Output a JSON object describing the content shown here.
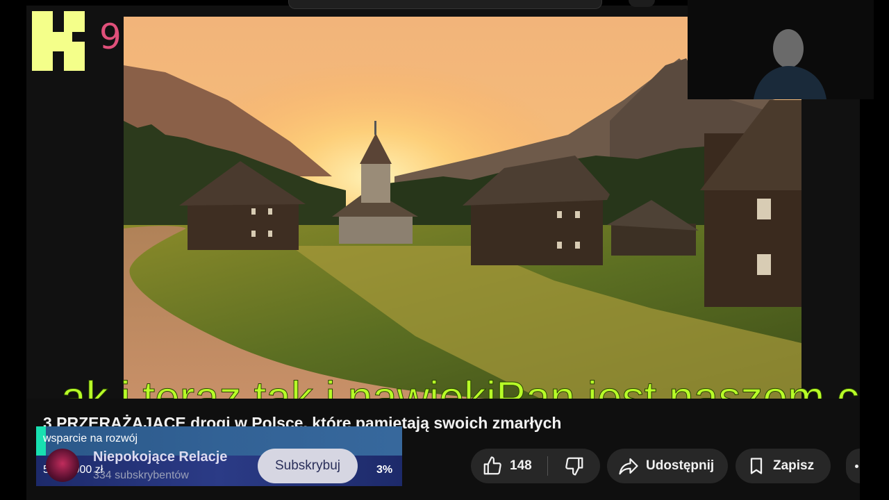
{
  "logo": {
    "letter_icon": "k-logo-icon",
    "number": "9"
  },
  "video": {
    "scene": "village-at-sunset-thumbnail"
  },
  "subtitle": {
    "text": "ak i teraz tak i nawiekiPan jest naszom c"
  },
  "video_title": "3 PRZERAŻAJĄCE drogi w Polsce, które pamiętają swoich zmarłych",
  "support_widget": {
    "label": "wsparcie na rozwój",
    "amount": "50  z  2000  zł",
    "percent": "3%",
    "progress": 0.03
  },
  "channel": {
    "name": "Niepokojące Relacje",
    "subscribers": "334 subskrybentów"
  },
  "actions": {
    "subscribe": "Subskrybuj",
    "like_count": "148",
    "share": "Udostępnij",
    "save": "Zapisz"
  },
  "colors": {
    "subtitle": "#b8ff28",
    "logo": "#f4ff8a",
    "logo_number": "#e0507a",
    "support_accent": "#18e0b0"
  }
}
